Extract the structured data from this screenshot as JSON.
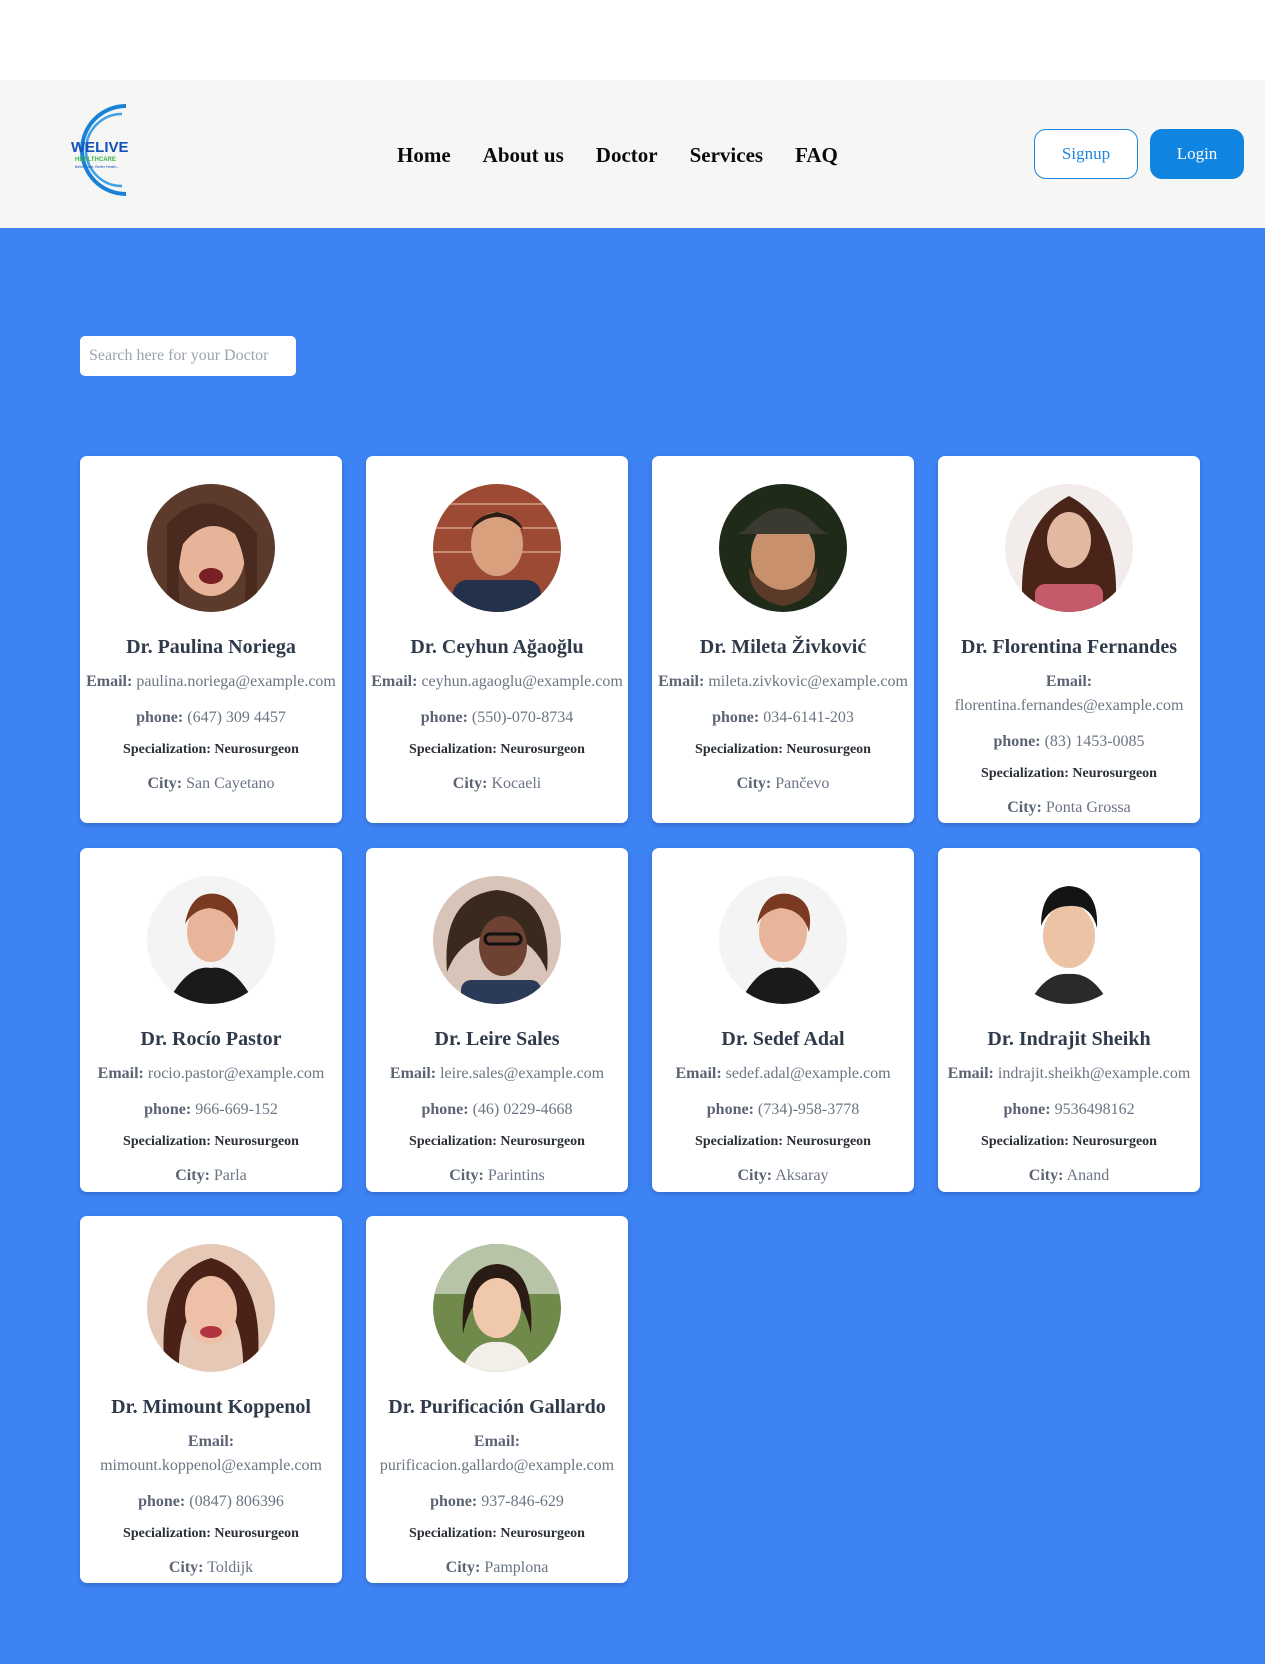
{
  "brand": {
    "logo_text": "WELIVE",
    "logo_sub": "HEALTHCARE",
    "logo_tagline": "Better Care, Better Health...",
    "colors": {
      "ring": "#1a82d6",
      "text": "#1452b8",
      "sub": "#39b54a"
    }
  },
  "nav": {
    "links": [
      "Home",
      "About us",
      "Doctor",
      "Services",
      "FAQ"
    ],
    "signup_label": "Signup",
    "login_label": "Login"
  },
  "search": {
    "placeholder": "Search here for your Doctor",
    "value": ""
  },
  "labels": {
    "email": "Email:",
    "phone": "phone:",
    "specialization": "Specialization:",
    "city": "City:"
  },
  "doctors": [
    {
      "name": "Dr. Paulina Noriega",
      "email": "paulina.noriega@example.com",
      "phone": "(647) 309 4457",
      "specialization": "Neurosurgeon",
      "city": "San Cayetano"
    },
    {
      "name": "Dr. Ceyhun Ağaoğlu",
      "email": "ceyhun.agaoglu@example.com",
      "phone": "(550)-070-8734",
      "specialization": "Neurosurgeon",
      "city": "Kocaeli"
    },
    {
      "name": "Dr. Mileta Živković",
      "email": "mileta.zivkovic@example.com",
      "phone": "034-6141-203",
      "specialization": "Neurosurgeon",
      "city": "Pančevo"
    },
    {
      "name": "Dr. Florentina Fernandes",
      "email": "florentina.fernandes@example.com",
      "phone": "(83) 1453-0085",
      "specialization": "Neurosurgeon",
      "city": "Ponta Grossa"
    },
    {
      "name": "Dr. Rocío Pastor",
      "email": "rocio.pastor@example.com",
      "phone": "966-669-152",
      "specialization": "Neurosurgeon",
      "city": "Parla"
    },
    {
      "name": "Dr. Leire Sales",
      "email": "leire.sales@example.com",
      "phone": "(46) 0229-4668",
      "specialization": "Neurosurgeon",
      "city": "Parintins"
    },
    {
      "name": "Dr. Sedef Adal",
      "email": "sedef.adal@example.com",
      "phone": "(734)-958-3778",
      "specialization": "Neurosurgeon",
      "city": "Aksaray"
    },
    {
      "name": "Dr. Indrajit Sheikh",
      "email": "indrajit.sheikh@example.com",
      "phone": "9536498162",
      "specialization": "Neurosurgeon",
      "city": "Anand"
    },
    {
      "name": "Dr. Mimount Koppenol",
      "email": "mimount.koppenol@example.com",
      "phone": "(0847) 806396",
      "specialization": "Neurosurgeon",
      "city": "Toldijk"
    },
    {
      "name": "Dr. Purificación Gallardo",
      "email": "purificacion.gallardo@example.com",
      "phone": "937-846-629",
      "specialization": "Neurosurgeon",
      "city": "Pamplona"
    }
  ],
  "colors": {
    "page_bg": "#3d83f4",
    "navbar_bg": "#f6f6f4",
    "login_bg": "#0f84e0",
    "signup_border": "#1f87df"
  }
}
